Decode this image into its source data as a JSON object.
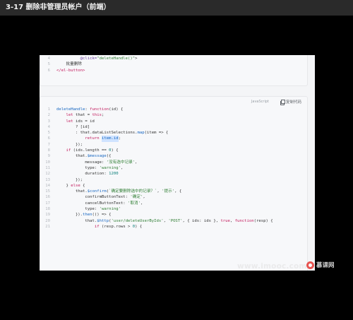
{
  "title": "3-17 删除非管理员帐户（前端）",
  "card1": {
    "lines": [
      {
        "n": "4",
        "segs": [
          {
            "t": "          @click=",
            "c": "t-prop"
          },
          {
            "t": "\"deleteHandle()\"",
            "c": "t-str"
          },
          {
            "t": ">",
            "c": "txt"
          }
        ]
      },
      {
        "n": "5",
        "segs": [
          {
            "t": "    批量删除",
            "c": "txt"
          }
        ]
      },
      {
        "n": "6",
        "segs": [
          {
            "t": "</el-button>",
            "c": "t-kw"
          }
        ]
      }
    ]
  },
  "card2": {
    "language": "JavaScript",
    "copy_label": "复制代码",
    "lines": [
      {
        "n": "1",
        "segs": [
          {
            "t": "deleteHandle",
            "c": "t-fn"
          },
          {
            "t": ": ",
            "c": "txt"
          },
          {
            "t": "function",
            "c": "t-kw"
          },
          {
            "t": "(id) {",
            "c": "txt"
          }
        ]
      },
      {
        "n": "2",
        "segs": [
          {
            "t": "    ",
            "c": "txt"
          },
          {
            "t": "let",
            "c": "t-kw"
          },
          {
            "t": " that = ",
            "c": "txt"
          },
          {
            "t": "this",
            "c": "t-kw"
          },
          {
            "t": ";",
            "c": "txt"
          }
        ]
      },
      {
        "n": "3",
        "segs": [
          {
            "t": "    ",
            "c": "txt"
          },
          {
            "t": "let",
            "c": "t-kw"
          },
          {
            "t": " ids = id",
            "c": "txt"
          }
        ]
      },
      {
        "n": "4",
        "segs": [
          {
            "t": "        ? [id]",
            "c": "txt"
          }
        ]
      },
      {
        "n": "5",
        "segs": [
          {
            "t": "        : that.dataListSelections.",
            "c": "txt"
          },
          {
            "t": "map",
            "c": "t-fn"
          },
          {
            "t": "(item => {",
            "c": "txt"
          }
        ]
      },
      {
        "n": "6",
        "segs": [
          {
            "t": "            ",
            "c": "txt"
          },
          {
            "t": "return",
            "c": "t-kw"
          },
          {
            "t": " ",
            "c": "txt"
          },
          {
            "t": "item.id",
            "c": "t-hl"
          },
          {
            "t": ";",
            "c": "txt"
          }
        ]
      },
      {
        "n": "7",
        "segs": [
          {
            "t": "        });",
            "c": "txt"
          }
        ]
      },
      {
        "n": "8",
        "segs": [
          {
            "t": "    ",
            "c": "txt"
          },
          {
            "t": "if",
            "c": "t-kw"
          },
          {
            "t": " (ids.length == ",
            "c": "txt"
          },
          {
            "t": "0",
            "c": "t-num"
          },
          {
            "t": ") {",
            "c": "txt"
          }
        ]
      },
      {
        "n": "9",
        "segs": [
          {
            "t": "        that.",
            "c": "txt"
          },
          {
            "t": "$message",
            "c": "t-fn"
          },
          {
            "t": "({",
            "c": "txt"
          }
        ]
      },
      {
        "n": "10",
        "segs": [
          {
            "t": "            message: ",
            "c": "txt"
          },
          {
            "t": "'没有选中记录'",
            "c": "t-str"
          },
          {
            "t": ",",
            "c": "txt"
          }
        ]
      },
      {
        "n": "11",
        "segs": [
          {
            "t": "            type: ",
            "c": "txt"
          },
          {
            "t": "'warning'",
            "c": "t-str"
          },
          {
            "t": ",",
            "c": "txt"
          }
        ]
      },
      {
        "n": "12",
        "segs": [
          {
            "t": "            duration: ",
            "c": "txt"
          },
          {
            "t": "1200",
            "c": "t-num"
          }
        ]
      },
      {
        "n": "13",
        "segs": [
          {
            "t": "        });",
            "c": "txt"
          }
        ]
      },
      {
        "n": "14",
        "segs": [
          {
            "t": "    } ",
            "c": "txt"
          },
          {
            "t": "else",
            "c": "t-kw"
          },
          {
            "t": " {",
            "c": "txt"
          }
        ]
      },
      {
        "n": "15",
        "segs": [
          {
            "t": "        that.",
            "c": "txt"
          },
          {
            "t": "$confirm",
            "c": "t-fn"
          },
          {
            "t": "(",
            "c": "txt"
          },
          {
            "t": "`确定要删除选中的记录？`",
            "c": "t-str"
          },
          {
            "t": ", ",
            "c": "txt"
          },
          {
            "t": "'提示'",
            "c": "t-str"
          },
          {
            "t": ", {",
            "c": "txt"
          }
        ]
      },
      {
        "n": "16",
        "segs": [
          {
            "t": "            confirmButtonText: ",
            "c": "txt"
          },
          {
            "t": "'确定'",
            "c": "t-str"
          },
          {
            "t": ",",
            "c": "txt"
          }
        ]
      },
      {
        "n": "17",
        "segs": [
          {
            "t": "            cancelButtonText: ",
            "c": "txt"
          },
          {
            "t": "'取消'",
            "c": "t-str"
          },
          {
            "t": ",",
            "c": "txt"
          }
        ]
      },
      {
        "n": "18",
        "segs": [
          {
            "t": "            type: ",
            "c": "txt"
          },
          {
            "t": "'warning'",
            "c": "t-str"
          }
        ]
      },
      {
        "n": "19",
        "segs": [
          {
            "t": "        }).",
            "c": "txt"
          },
          {
            "t": "then",
            "c": "t-fn"
          },
          {
            "t": "(() => {",
            "c": "txt"
          }
        ]
      },
      {
        "n": "20",
        "segs": [
          {
            "t": "            that.",
            "c": "txt"
          },
          {
            "t": "$http",
            "c": "t-fn"
          },
          {
            "t": "(",
            "c": "txt"
          },
          {
            "t": "'user/deleteUserByIds'",
            "c": "t-str"
          },
          {
            "t": ", ",
            "c": "txt"
          },
          {
            "t": "'POST'",
            "c": "t-str"
          },
          {
            "t": ", { ids: ids }, ",
            "c": "txt"
          },
          {
            "t": "true",
            "c": "t-kw"
          },
          {
            "t": ", ",
            "c": "txt"
          },
          {
            "t": "function",
            "c": "t-kw"
          },
          {
            "t": "(resp) {",
            "c": "txt"
          }
        ]
      },
      {
        "n": "21",
        "segs": [
          {
            "t": "                ",
            "c": "txt"
          },
          {
            "t": "if",
            "c": "t-kw"
          },
          {
            "t": " (resp.rows > ",
            "c": "txt"
          },
          {
            "t": "0",
            "c": "t-num"
          },
          {
            "t": ") {",
            "c": "txt"
          }
        ]
      }
    ]
  },
  "watermark": "www.imooc.com",
  "logo_text": "慕课网"
}
